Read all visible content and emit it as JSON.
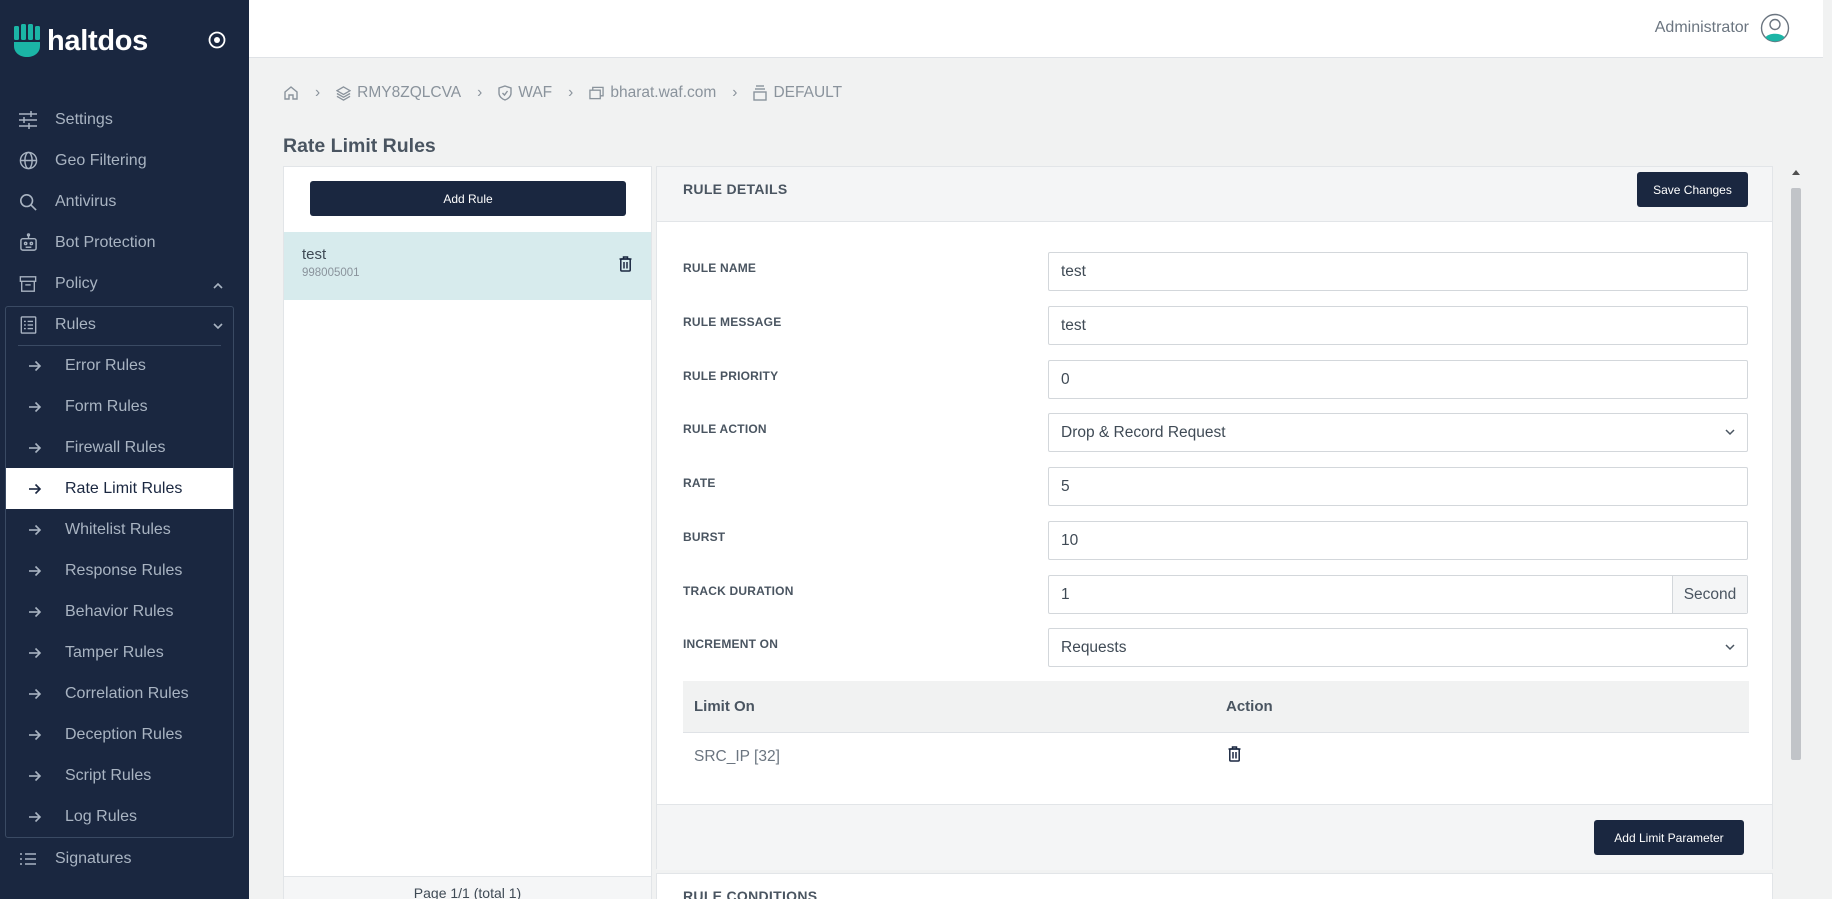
{
  "brand": {
    "name": "haltdos"
  },
  "user": {
    "name": "Administrator"
  },
  "sidebar": {
    "items": [
      {
        "label": "Settings",
        "icon": "sliders-icon"
      },
      {
        "label": "Geo Filtering",
        "icon": "globe-icon"
      },
      {
        "label": "Antivirus",
        "icon": "search-icon"
      },
      {
        "label": "Bot Protection",
        "icon": "robot-icon"
      },
      {
        "label": "Policy",
        "icon": "archive-icon"
      },
      {
        "label": "Rules",
        "icon": "list-icon"
      }
    ],
    "rules_children": [
      "Error Rules",
      "Form Rules",
      "Firewall Rules",
      "Rate Limit Rules",
      "Whitelist Rules",
      "Response Rules",
      "Behavior Rules",
      "Tamper Rules",
      "Correlation Rules",
      "Deception Rules",
      "Script Rules",
      "Log Rules"
    ],
    "active_child": "Rate Limit Rules",
    "signatures": {
      "label": "Signatures",
      "icon": "list-icon"
    }
  },
  "breadcrumb": {
    "items": [
      {
        "label": "RMY8ZQLCVA",
        "icon": "layers-icon"
      },
      {
        "label": "WAF",
        "icon": "shield-icon"
      },
      {
        "label": "bharat.waf.com",
        "icon": "window-icon"
      },
      {
        "label": "DEFAULT",
        "icon": "stack-icon"
      }
    ]
  },
  "page": {
    "title": "Rate Limit Rules"
  },
  "rule_list": {
    "add_label": "Add Rule",
    "rules": [
      {
        "name": "test",
        "id": "998005001"
      }
    ],
    "pager": "Page 1/1 (total 1)"
  },
  "details": {
    "title": "RULE DETAILS",
    "save_label": "Save Changes",
    "fields": {
      "rule_name": {
        "label": "RULE NAME",
        "value": "test"
      },
      "rule_message": {
        "label": "RULE MESSAGE",
        "value": "test"
      },
      "rule_priority": {
        "label": "RULE PRIORITY",
        "value": "0"
      },
      "rule_action": {
        "label": "RULE ACTION",
        "value": "Drop & Record Request"
      },
      "rate": {
        "label": "RATE",
        "value": "5"
      },
      "burst": {
        "label": "BURST",
        "value": "10"
      },
      "track_duration": {
        "label": "TRACK DURATION",
        "value": "1",
        "unit": "Second"
      },
      "increment_on": {
        "label": "INCREMENT ON",
        "value": "Requests"
      }
    },
    "limit_table": {
      "headers": [
        "Limit On",
        "Action"
      ],
      "rows": [
        {
          "limit_on": "SRC_IP [32]"
        }
      ]
    },
    "add_limit_label": "Add Limit Parameter"
  },
  "conditions": {
    "title": "RULE CONDITIONS"
  },
  "colors": {
    "sidebar_bg": "#1a2740",
    "accent_teal": "#1bb5a6",
    "selected_row": "#d7ebed"
  }
}
